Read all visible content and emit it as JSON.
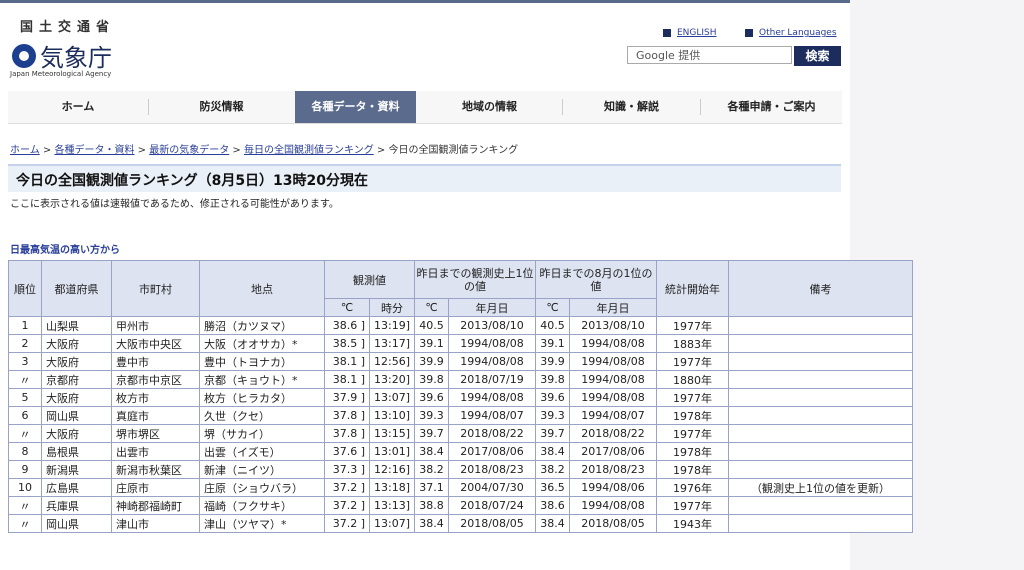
{
  "header": {
    "ministry": "国土交通省",
    "agency_name": "気象庁",
    "agency_en": "Japan Meteorological Agency",
    "lang_english": "ENGLISH",
    "lang_other": "Other Languages",
    "search_placeholder": "Google 提供",
    "search_button": "検索"
  },
  "nav": {
    "items": [
      "ホーム",
      "防災情報",
      "各種データ・資料",
      "地域の情報",
      "知識・解説",
      "各種申請・ご案内"
    ],
    "active_index": 2
  },
  "breadcrumb": {
    "links": [
      "ホーム",
      "各種データ・資料",
      "最新の気象データ",
      "毎日の全国観測値ランキング"
    ],
    "current": "今日の全国観測値ランキング",
    "separator": ">"
  },
  "page_title": "今日の全国観測値ランキング（8月5日）13時20分現在",
  "note": "ここに表示される値は速報値であるため、修正される可能性があります。",
  "section_title": "日最高気温の高い方から",
  "table": {
    "headers": {
      "rank": "順位",
      "prefecture": "都道府県",
      "city": "市町村",
      "station": "地点",
      "observed": "観測値",
      "record": "昨日までの観測史上1位の値",
      "august": "昨日までの8月の1位の値",
      "start_year": "統計開始年",
      "remarks": "備考",
      "celsius": "℃",
      "time": "時分",
      "date": "年月日"
    },
    "rows": [
      {
        "rank": "1",
        "pref": "山梨県",
        "city": "甲州市",
        "station": "勝沼（カツヌマ）",
        "temp": "38.6 ]",
        "time": "13:19]",
        "rec_temp": "40.5",
        "rec_date": "2013/08/10",
        "aug_temp": "40.5",
        "aug_date": "2013/08/10",
        "start": "1977年",
        "remark": ""
      },
      {
        "rank": "2",
        "pref": "大阪府",
        "city": "大阪市中央区",
        "station": "大阪（オオサカ）*",
        "temp": "38.5 ]",
        "time": "13:17]",
        "rec_temp": "39.1",
        "rec_date": "1994/08/08",
        "aug_temp": "39.1",
        "aug_date": "1994/08/08",
        "start": "1883年",
        "remark": ""
      },
      {
        "rank": "3",
        "pref": "大阪府",
        "city": "豊中市",
        "station": "豊中（トヨナカ）",
        "temp": "38.1 ]",
        "time": "12:56]",
        "rec_temp": "39.9",
        "rec_date": "1994/08/08",
        "aug_temp": "39.9",
        "aug_date": "1994/08/08",
        "start": "1977年",
        "remark": ""
      },
      {
        "rank": "〃",
        "pref": "京都府",
        "city": "京都市中京区",
        "station": "京都（キョウト）*",
        "temp": "38.1 ]",
        "time": "13:20]",
        "rec_temp": "39.8",
        "rec_date": "2018/07/19",
        "aug_temp": "39.8",
        "aug_date": "1994/08/08",
        "start": "1880年",
        "remark": ""
      },
      {
        "rank": "5",
        "pref": "大阪府",
        "city": "枚方市",
        "station": "枚方（ヒラカタ）",
        "temp": "37.9 ]",
        "time": "13:07]",
        "rec_temp": "39.6",
        "rec_date": "1994/08/08",
        "aug_temp": "39.6",
        "aug_date": "1994/08/08",
        "start": "1977年",
        "remark": ""
      },
      {
        "rank": "6",
        "pref": "岡山県",
        "city": "真庭市",
        "station": "久世（クセ）",
        "temp": "37.8 ]",
        "time": "13:10]",
        "rec_temp": "39.3",
        "rec_date": "1994/08/07",
        "aug_temp": "39.3",
        "aug_date": "1994/08/07",
        "start": "1978年",
        "remark": ""
      },
      {
        "rank": "〃",
        "pref": "大阪府",
        "city": "堺市堺区",
        "station": "堺（サカイ）",
        "temp": "37.8 ]",
        "time": "13:15]",
        "rec_temp": "39.7",
        "rec_date": "2018/08/22",
        "aug_temp": "39.7",
        "aug_date": "2018/08/22",
        "start": "1977年",
        "remark": ""
      },
      {
        "rank": "8",
        "pref": "島根県",
        "city": "出雲市",
        "station": "出雲（イズモ）",
        "temp": "37.6 ]",
        "time": "13:01]",
        "rec_temp": "38.4",
        "rec_date": "2017/08/06",
        "aug_temp": "38.4",
        "aug_date": "2017/08/06",
        "start": "1978年",
        "remark": ""
      },
      {
        "rank": "9",
        "pref": "新潟県",
        "city": "新潟市秋葉区",
        "station": "新津（ニイツ）",
        "temp": "37.3 ]",
        "time": "12:16]",
        "rec_temp": "38.2",
        "rec_date": "2018/08/23",
        "aug_temp": "38.2",
        "aug_date": "2018/08/23",
        "start": "1978年",
        "remark": ""
      },
      {
        "rank": "10",
        "pref": "広島県",
        "city": "庄原市",
        "station": "庄原（ショウバラ）",
        "temp": "37.2 ]",
        "time": "13:18]",
        "rec_temp": "37.1",
        "rec_date": "2004/07/30",
        "aug_temp": "36.5",
        "aug_date": "1994/08/06",
        "start": "1976年",
        "remark": "（観測史上1位の値を更新）"
      },
      {
        "rank": "〃",
        "pref": "兵庫県",
        "city": "神崎郡福崎町",
        "station": "福崎（フクサキ）",
        "temp": "37.2 ]",
        "time": "13:13]",
        "rec_temp": "38.8",
        "rec_date": "2018/07/24",
        "aug_temp": "38.6",
        "aug_date": "1994/08/08",
        "start": "1977年",
        "remark": ""
      },
      {
        "rank": "〃",
        "pref": "岡山県",
        "city": "津山市",
        "station": "津山（ツヤマ）*",
        "temp": "37.2 ]",
        "time": "13:07]",
        "rec_temp": "38.4",
        "rec_date": "2018/08/05",
        "aug_temp": "38.4",
        "aug_date": "2018/08/05",
        "start": "1943年",
        "remark": ""
      }
    ]
  }
}
